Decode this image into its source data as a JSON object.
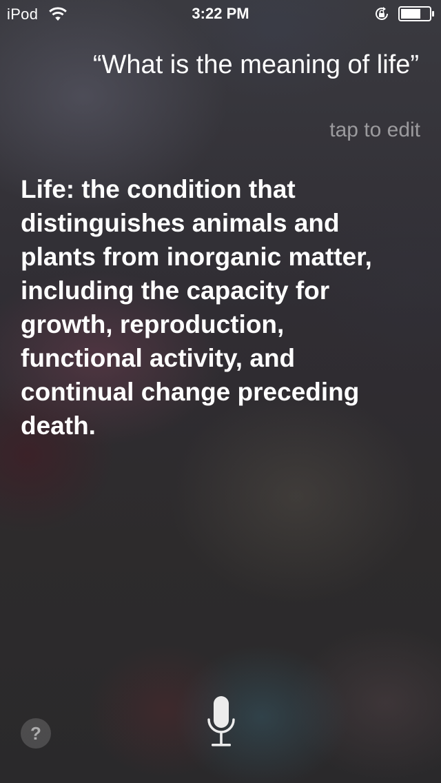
{
  "status_bar": {
    "carrier": "iPod",
    "time": "3:22 PM",
    "icons": [
      "wifi-icon",
      "rotation-lock-icon",
      "battery-icon"
    ]
  },
  "siri": {
    "query": "“What is the meaning of life”",
    "edit_hint": "tap to edit",
    "answer": "Life: the condition that distinguishes animals and plants from inorganic matter, including the capacity for growth, reproduction, functional activity, and continual change preceding death."
  },
  "controls": {
    "help_label": "?",
    "mic_icon": "microphone-icon"
  },
  "colors": {
    "text": "#ffffff",
    "muted_text": "rgba(255,255,255,0.5)"
  }
}
